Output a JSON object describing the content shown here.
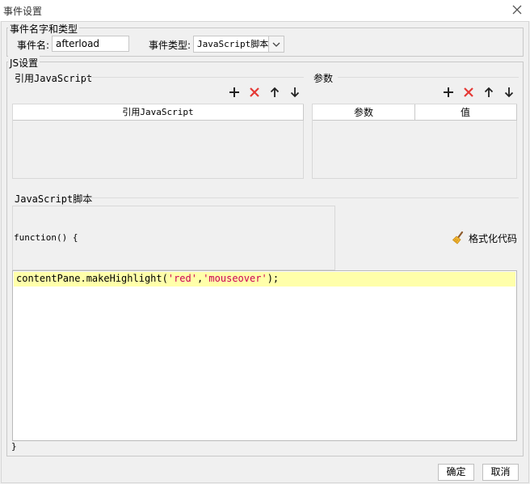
{
  "window": {
    "title": "事件设置"
  },
  "event_section": {
    "legend": "事件名字和类型",
    "name_label": "事件名:",
    "name_value": "afterload",
    "type_label": "事件类型:",
    "type_value": "JavaScript脚本"
  },
  "js_section": {
    "legend": "JS设置",
    "ref": {
      "label": "引用JavaScript",
      "column": "引用JavaScript",
      "rows": []
    },
    "params": {
      "label": "参数",
      "columns": [
        "参数",
        "值"
      ],
      "rows": []
    },
    "script": {
      "label": "JavaScript脚本",
      "function_open": "function() {",
      "format_button": "格式化代码",
      "code_method": "contentPane.makeHighlight(",
      "code_arg1": "'red'",
      "code_comma": ",",
      "code_arg2": "'mouseover'",
      "code_end": ");",
      "function_close": "}"
    }
  },
  "footer": {
    "ok": "确定",
    "cancel": "取消"
  },
  "colors": {
    "add": "#222222",
    "delete": "#e53935",
    "highlight": "#ffffaa",
    "string": "#cc0055"
  },
  "icons": [
    "close-icon",
    "chevron-down-icon",
    "plus-icon",
    "delete-x-icon",
    "arrow-up-icon",
    "arrow-down-icon",
    "broom-icon"
  ]
}
